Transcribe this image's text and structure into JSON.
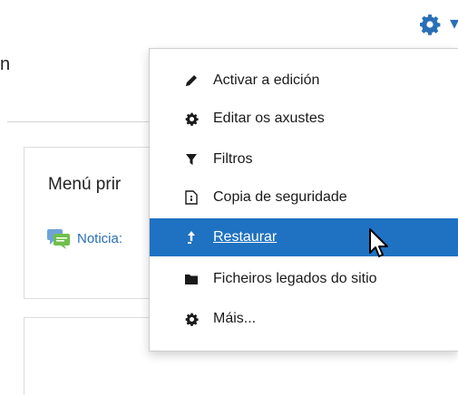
{
  "header": {
    "partial_text": "n"
  },
  "settings_button": {
    "icon": "gear-icon",
    "caret": "▾",
    "color": "#2a6fb6"
  },
  "block": {
    "title": "Menú prir",
    "link_label": "Noticia:",
    "link_icon": "chat-bubbles-icon"
  },
  "menu": {
    "items": [
      {
        "label": "Activar a edición",
        "icon": "pencil-icon"
      },
      {
        "label": "Editar os axustes",
        "icon": "gear-icon"
      },
      {
        "label": "Filtros",
        "icon": "filter-icon"
      },
      {
        "label": "Copia de seguridade",
        "icon": "file-archive-icon"
      },
      {
        "label": "Restaurar",
        "icon": "upload-icon",
        "active": true
      },
      {
        "label": "Ficheiros legados do sitio",
        "icon": "folder-icon"
      },
      {
        "label": "Máis...",
        "icon": "gear-icon"
      }
    ],
    "active_color": "#1f72c1"
  }
}
